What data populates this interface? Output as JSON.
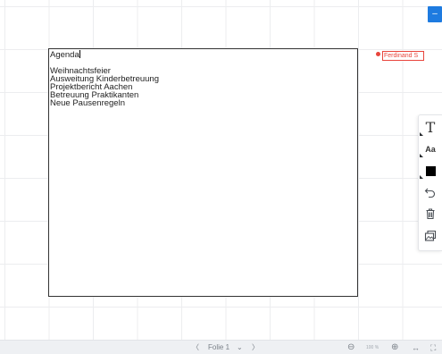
{
  "textbox": {
    "lines": [
      "Agenda",
      "",
      "Weihnachtsfeier",
      "Ausweitung Kinderbetreuung",
      "Projektbericht Aachen",
      "Betreuung Praktikanten",
      "Neue Pausenregeln"
    ]
  },
  "collaborator": {
    "name": "Ferdinand S",
    "color": "#e8453c"
  },
  "topright": {
    "symbol": "–"
  },
  "toolbar": {
    "items": [
      {
        "name": "text-format-icon",
        "glyph": "T"
      },
      {
        "name": "font-style-icon",
        "glyph": "Aa"
      },
      {
        "name": "color-swatch",
        "color": "#000000"
      },
      {
        "name": "undo-icon"
      },
      {
        "name": "trash-icon"
      },
      {
        "name": "picture-icon"
      }
    ]
  },
  "statusbar": {
    "prev": "〈",
    "slide_label": "Folie 1",
    "dropdown": "⌄",
    "next": "〉",
    "zoom_out": "⊖",
    "zoom_level": "100 %",
    "zoom_in": "⊕",
    "fit_width": "↔",
    "fullscreen": "⛶"
  }
}
